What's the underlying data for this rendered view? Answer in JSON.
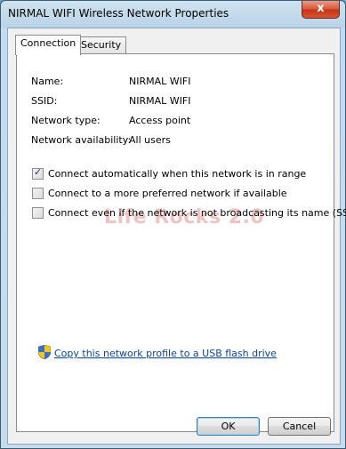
{
  "window": {
    "title": "NIRMAL WIFI Wireless Network Properties",
    "close_icon": "close-icon",
    "close_glyph": "x"
  },
  "tabs": [
    {
      "label": "Connection",
      "active": true
    },
    {
      "label": "Security",
      "active": false
    }
  ],
  "properties": [
    {
      "label": "Name:",
      "value": "NIRMAL WIFI"
    },
    {
      "label": "SSID:",
      "value": "NIRMAL WIFI"
    },
    {
      "label": "Network type:",
      "value": "Access point"
    },
    {
      "label": "Network availability:",
      "value": "All users"
    }
  ],
  "options": [
    {
      "label": "Connect automatically when this network is in range",
      "checked": true
    },
    {
      "label": "Connect to a more preferred network if available",
      "checked": false
    },
    {
      "label": "Connect even if the network is not broadcasting its name (SSID)",
      "checked": false
    }
  ],
  "watermark": "Life Rocks 2.0",
  "usb_link": {
    "label": "Copy this network profile to a USB flash drive",
    "icon": "shield-icon"
  },
  "buttons": {
    "ok": "OK",
    "cancel": "Cancel"
  },
  "colors": {
    "link": "#0645ad",
    "accent": "#3c7fb1"
  }
}
